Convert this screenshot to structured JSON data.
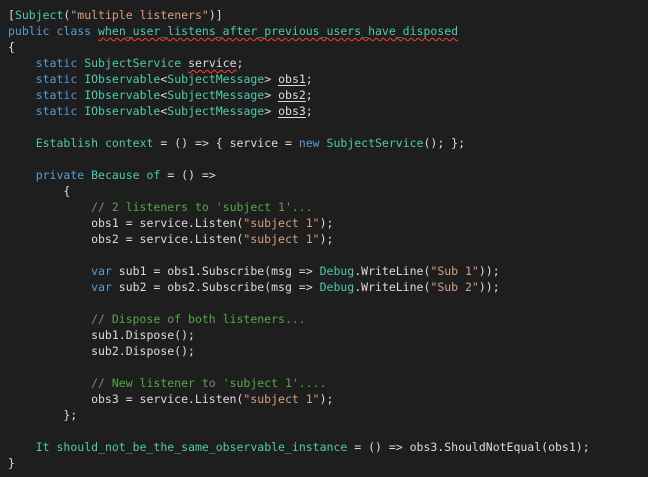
{
  "editor": {
    "colors": {
      "background": "#1e1e1e",
      "default_text": "#dcdcdc",
      "keyword": "#569cd6",
      "type": "#4ec9b0",
      "string": "#d69d85",
      "comment": "#57a64a",
      "squiggle": "#ff3b3b"
    },
    "lines": [
      [
        {
          "k": "punct",
          "v": "["
        },
        {
          "k": "type",
          "v": "Subject"
        },
        {
          "k": "punct",
          "v": "("
        },
        {
          "k": "str",
          "v": "\"multiple listeners\""
        },
        {
          "k": "punct",
          "v": ")]"
        }
      ],
      [
        {
          "k": "kw",
          "v": "public"
        },
        {
          "k": "punct",
          "v": " "
        },
        {
          "k": "kw",
          "v": "class"
        },
        {
          "k": "punct",
          "v": " "
        },
        {
          "k": "type",
          "v": "when_user_listens_after_previous_users_have_disposed",
          "d": "squiggle"
        }
      ],
      [
        {
          "k": "punct",
          "v": "{"
        }
      ],
      [
        {
          "k": "punct",
          "v": "    "
        },
        {
          "k": "kw",
          "v": "static"
        },
        {
          "k": "punct",
          "v": " "
        },
        {
          "k": "type",
          "v": "SubjectService"
        },
        {
          "k": "punct",
          "v": " "
        },
        {
          "k": "ident",
          "v": "service",
          "d": "squiggle"
        },
        {
          "k": "punct",
          "v": ";"
        }
      ],
      [
        {
          "k": "punct",
          "v": "    "
        },
        {
          "k": "kw",
          "v": "static"
        },
        {
          "k": "punct",
          "v": " "
        },
        {
          "k": "type",
          "v": "IObservable"
        },
        {
          "k": "punct",
          "v": "<"
        },
        {
          "k": "type",
          "v": "SubjectMessage"
        },
        {
          "k": "punct",
          "v": "> "
        },
        {
          "k": "ident",
          "v": "obs1",
          "d": "underline"
        },
        {
          "k": "punct",
          "v": ";"
        }
      ],
      [
        {
          "k": "punct",
          "v": "    "
        },
        {
          "k": "kw",
          "v": "static"
        },
        {
          "k": "punct",
          "v": " "
        },
        {
          "k": "type",
          "v": "IObservable"
        },
        {
          "k": "punct",
          "v": "<"
        },
        {
          "k": "type",
          "v": "SubjectMessage"
        },
        {
          "k": "punct",
          "v": "> "
        },
        {
          "k": "ident",
          "v": "obs2",
          "d": "underline"
        },
        {
          "k": "punct",
          "v": ";"
        }
      ],
      [
        {
          "k": "punct",
          "v": "    "
        },
        {
          "k": "kw",
          "v": "static"
        },
        {
          "k": "punct",
          "v": " "
        },
        {
          "k": "type",
          "v": "IObservable"
        },
        {
          "k": "punct",
          "v": "<"
        },
        {
          "k": "type",
          "v": "SubjectMessage"
        },
        {
          "k": "punct",
          "v": "> "
        },
        {
          "k": "ident",
          "v": "obs3",
          "d": "underline"
        },
        {
          "k": "punct",
          "v": ";"
        }
      ],
      [],
      [
        {
          "k": "punct",
          "v": "    "
        },
        {
          "k": "type",
          "v": "Establish"
        },
        {
          "k": "punct",
          "v": " "
        },
        {
          "k": "type",
          "v": "context"
        },
        {
          "k": "punct",
          "v": " = () => { service = "
        },
        {
          "k": "kw",
          "v": "new"
        },
        {
          "k": "punct",
          "v": " "
        },
        {
          "k": "type",
          "v": "SubjectService"
        },
        {
          "k": "punct",
          "v": "(); };"
        }
      ],
      [],
      [
        {
          "k": "punct",
          "v": "    "
        },
        {
          "k": "kw",
          "v": "private"
        },
        {
          "k": "punct",
          "v": " "
        },
        {
          "k": "type",
          "v": "Because"
        },
        {
          "k": "punct",
          "v": " "
        },
        {
          "k": "type",
          "v": "of"
        },
        {
          "k": "punct",
          "v": " = () =>"
        }
      ],
      [
        {
          "k": "punct",
          "v": "        {"
        }
      ],
      [
        {
          "k": "punct",
          "v": "            "
        },
        {
          "k": "comment",
          "v": "// 2 listeners to 'subject 1'..."
        }
      ],
      [
        {
          "k": "punct",
          "v": "            obs1 = service.Listen("
        },
        {
          "k": "str",
          "v": "\"subject 1\""
        },
        {
          "k": "punct",
          "v": ");"
        }
      ],
      [
        {
          "k": "punct",
          "v": "            obs2 = service.Listen("
        },
        {
          "k": "str",
          "v": "\"subject 1\""
        },
        {
          "k": "punct",
          "v": ");"
        }
      ],
      [],
      [
        {
          "k": "punct",
          "v": "            "
        },
        {
          "k": "kw",
          "v": "var"
        },
        {
          "k": "punct",
          "v": " sub1 = obs1.Subscribe(msg => "
        },
        {
          "k": "type",
          "v": "Debug"
        },
        {
          "k": "punct",
          "v": ".WriteLine("
        },
        {
          "k": "str",
          "v": "\"Sub 1\""
        },
        {
          "k": "punct",
          "v": "));"
        }
      ],
      [
        {
          "k": "punct",
          "v": "            "
        },
        {
          "k": "kw",
          "v": "var"
        },
        {
          "k": "punct",
          "v": " sub2 = obs2.Subscribe(msg => "
        },
        {
          "k": "type",
          "v": "Debug"
        },
        {
          "k": "punct",
          "v": ".WriteLine("
        },
        {
          "k": "str",
          "v": "\"Sub 2\""
        },
        {
          "k": "punct",
          "v": "));"
        }
      ],
      [],
      [
        {
          "k": "punct",
          "v": "            "
        },
        {
          "k": "comment",
          "v": "// Dispose of both listeners..."
        }
      ],
      [
        {
          "k": "punct",
          "v": "            sub1.Dispose();"
        }
      ],
      [
        {
          "k": "punct",
          "v": "            sub2.Dispose();"
        }
      ],
      [],
      [
        {
          "k": "punct",
          "v": "            "
        },
        {
          "k": "comment",
          "v": "// New listener to 'subject 1'...."
        }
      ],
      [
        {
          "k": "punct",
          "v": "            obs3 = service.Listen("
        },
        {
          "k": "str",
          "v": "\"subject 1\""
        },
        {
          "k": "punct",
          "v": ");"
        }
      ],
      [
        {
          "k": "punct",
          "v": "        };"
        }
      ],
      [],
      [
        {
          "k": "punct",
          "v": "    "
        },
        {
          "k": "type",
          "v": "It"
        },
        {
          "k": "punct",
          "v": " "
        },
        {
          "k": "type",
          "v": "should_not_be_the_same_observable_instance"
        },
        {
          "k": "punct",
          "v": " = () => obs3.ShouldNotEqual(obs1);"
        }
      ],
      [
        {
          "k": "punct",
          "v": "}"
        }
      ]
    ]
  }
}
